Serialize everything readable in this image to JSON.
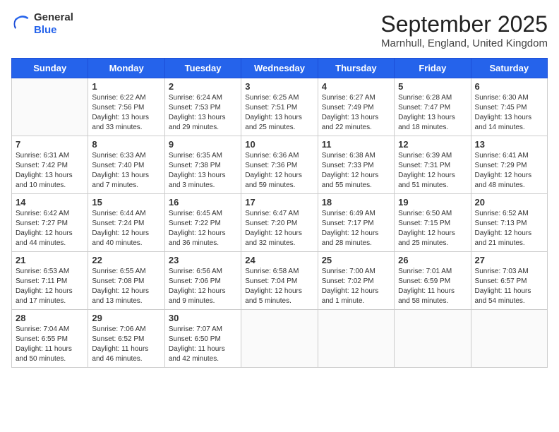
{
  "header": {
    "logo": {
      "general": "General",
      "blue": "Blue"
    },
    "month_year": "September 2025",
    "location": "Marnhull, England, United Kingdom"
  },
  "weekdays": [
    "Sunday",
    "Monday",
    "Tuesday",
    "Wednesday",
    "Thursday",
    "Friday",
    "Saturday"
  ],
  "weeks": [
    [
      {
        "day": null
      },
      {
        "day": 1,
        "sunrise": "6:22 AM",
        "sunset": "7:56 PM",
        "daylight": "13 hours and 33 minutes."
      },
      {
        "day": 2,
        "sunrise": "6:24 AM",
        "sunset": "7:53 PM",
        "daylight": "13 hours and 29 minutes."
      },
      {
        "day": 3,
        "sunrise": "6:25 AM",
        "sunset": "7:51 PM",
        "daylight": "13 hours and 25 minutes."
      },
      {
        "day": 4,
        "sunrise": "6:27 AM",
        "sunset": "7:49 PM",
        "daylight": "13 hours and 22 minutes."
      },
      {
        "day": 5,
        "sunrise": "6:28 AM",
        "sunset": "7:47 PM",
        "daylight": "13 hours and 18 minutes."
      },
      {
        "day": 6,
        "sunrise": "6:30 AM",
        "sunset": "7:45 PM",
        "daylight": "13 hours and 14 minutes."
      }
    ],
    [
      {
        "day": 7,
        "sunrise": "6:31 AM",
        "sunset": "7:42 PM",
        "daylight": "13 hours and 10 minutes."
      },
      {
        "day": 8,
        "sunrise": "6:33 AM",
        "sunset": "7:40 PM",
        "daylight": "13 hours and 7 minutes."
      },
      {
        "day": 9,
        "sunrise": "6:35 AM",
        "sunset": "7:38 PM",
        "daylight": "13 hours and 3 minutes."
      },
      {
        "day": 10,
        "sunrise": "6:36 AM",
        "sunset": "7:36 PM",
        "daylight": "12 hours and 59 minutes."
      },
      {
        "day": 11,
        "sunrise": "6:38 AM",
        "sunset": "7:33 PM",
        "daylight": "12 hours and 55 minutes."
      },
      {
        "day": 12,
        "sunrise": "6:39 AM",
        "sunset": "7:31 PM",
        "daylight": "12 hours and 51 minutes."
      },
      {
        "day": 13,
        "sunrise": "6:41 AM",
        "sunset": "7:29 PM",
        "daylight": "12 hours and 48 minutes."
      }
    ],
    [
      {
        "day": 14,
        "sunrise": "6:42 AM",
        "sunset": "7:27 PM",
        "daylight": "12 hours and 44 minutes."
      },
      {
        "day": 15,
        "sunrise": "6:44 AM",
        "sunset": "7:24 PM",
        "daylight": "12 hours and 40 minutes."
      },
      {
        "day": 16,
        "sunrise": "6:45 AM",
        "sunset": "7:22 PM",
        "daylight": "12 hours and 36 minutes."
      },
      {
        "day": 17,
        "sunrise": "6:47 AM",
        "sunset": "7:20 PM",
        "daylight": "12 hours and 32 minutes."
      },
      {
        "day": 18,
        "sunrise": "6:49 AM",
        "sunset": "7:17 PM",
        "daylight": "12 hours and 28 minutes."
      },
      {
        "day": 19,
        "sunrise": "6:50 AM",
        "sunset": "7:15 PM",
        "daylight": "12 hours and 25 minutes."
      },
      {
        "day": 20,
        "sunrise": "6:52 AM",
        "sunset": "7:13 PM",
        "daylight": "12 hours and 21 minutes."
      }
    ],
    [
      {
        "day": 21,
        "sunrise": "6:53 AM",
        "sunset": "7:11 PM",
        "daylight": "12 hours and 17 minutes."
      },
      {
        "day": 22,
        "sunrise": "6:55 AM",
        "sunset": "7:08 PM",
        "daylight": "12 hours and 13 minutes."
      },
      {
        "day": 23,
        "sunrise": "6:56 AM",
        "sunset": "7:06 PM",
        "daylight": "12 hours and 9 minutes."
      },
      {
        "day": 24,
        "sunrise": "6:58 AM",
        "sunset": "7:04 PM",
        "daylight": "12 hours and 5 minutes."
      },
      {
        "day": 25,
        "sunrise": "7:00 AM",
        "sunset": "7:02 PM",
        "daylight": "12 hours and 1 minute."
      },
      {
        "day": 26,
        "sunrise": "7:01 AM",
        "sunset": "6:59 PM",
        "daylight": "11 hours and 58 minutes."
      },
      {
        "day": 27,
        "sunrise": "7:03 AM",
        "sunset": "6:57 PM",
        "daylight": "11 hours and 54 minutes."
      }
    ],
    [
      {
        "day": 28,
        "sunrise": "7:04 AM",
        "sunset": "6:55 PM",
        "daylight": "11 hours and 50 minutes."
      },
      {
        "day": 29,
        "sunrise": "7:06 AM",
        "sunset": "6:52 PM",
        "daylight": "11 hours and 46 minutes."
      },
      {
        "day": 30,
        "sunrise": "7:07 AM",
        "sunset": "6:50 PM",
        "daylight": "11 hours and 42 minutes."
      },
      {
        "day": null
      },
      {
        "day": null
      },
      {
        "day": null
      },
      {
        "day": null
      }
    ]
  ]
}
